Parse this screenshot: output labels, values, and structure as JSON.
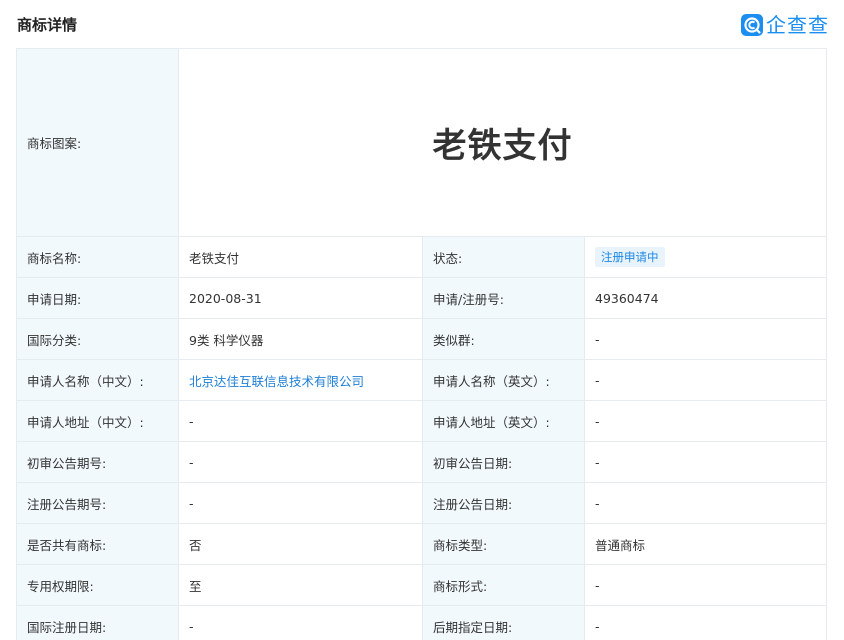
{
  "header": {
    "title": "商标详情",
    "brand_name": "企查查"
  },
  "trademark": {
    "pattern_label": "商标图案:",
    "pattern_text": "老铁支付"
  },
  "rows": [
    {
      "l1": "商标名称:",
      "v1": "老铁支付",
      "l2": "状态:",
      "v2": "注册申请中"
    },
    {
      "l1": "申请日期:",
      "v1": "2020-08-31",
      "l2": "申请/注册号:",
      "v2": "49360474"
    },
    {
      "l1": "国际分类:",
      "v1": "9类 科学仪器",
      "l2": "类似群:",
      "v2": "-"
    },
    {
      "l1": "申请人名称（中文）:",
      "v1": "北京达佳互联信息技术有限公司",
      "l2": "申请人名称（英文）:",
      "v2": "-"
    },
    {
      "l1": "申请人地址（中文）:",
      "v1": "-",
      "l2": "申请人地址（英文）:",
      "v2": "-"
    },
    {
      "l1": "初审公告期号:",
      "v1": "-",
      "l2": "初审公告日期:",
      "v2": "-"
    },
    {
      "l1": "注册公告期号:",
      "v1": "-",
      "l2": "注册公告日期:",
      "v2": "-"
    },
    {
      "l1": "是否共有商标:",
      "v1": "否",
      "l2": "商标类型:",
      "v2": "普通商标"
    },
    {
      "l1": "专用权期限:",
      "v1": "至",
      "l2": "商标形式:",
      "v2": "-"
    },
    {
      "l1": "国际注册日期:",
      "v1": "-",
      "l2": "后期指定日期:",
      "v2": "-"
    }
  ],
  "colors": {
    "label_bg": "#f2f9fd",
    "border": "#e6ebf0",
    "link": "#1e7fd6",
    "brand": "#1c8ef0",
    "badge_bg": "#e8f3fc"
  },
  "icons": {
    "brand_logo": "qichacha-logo-icon"
  }
}
